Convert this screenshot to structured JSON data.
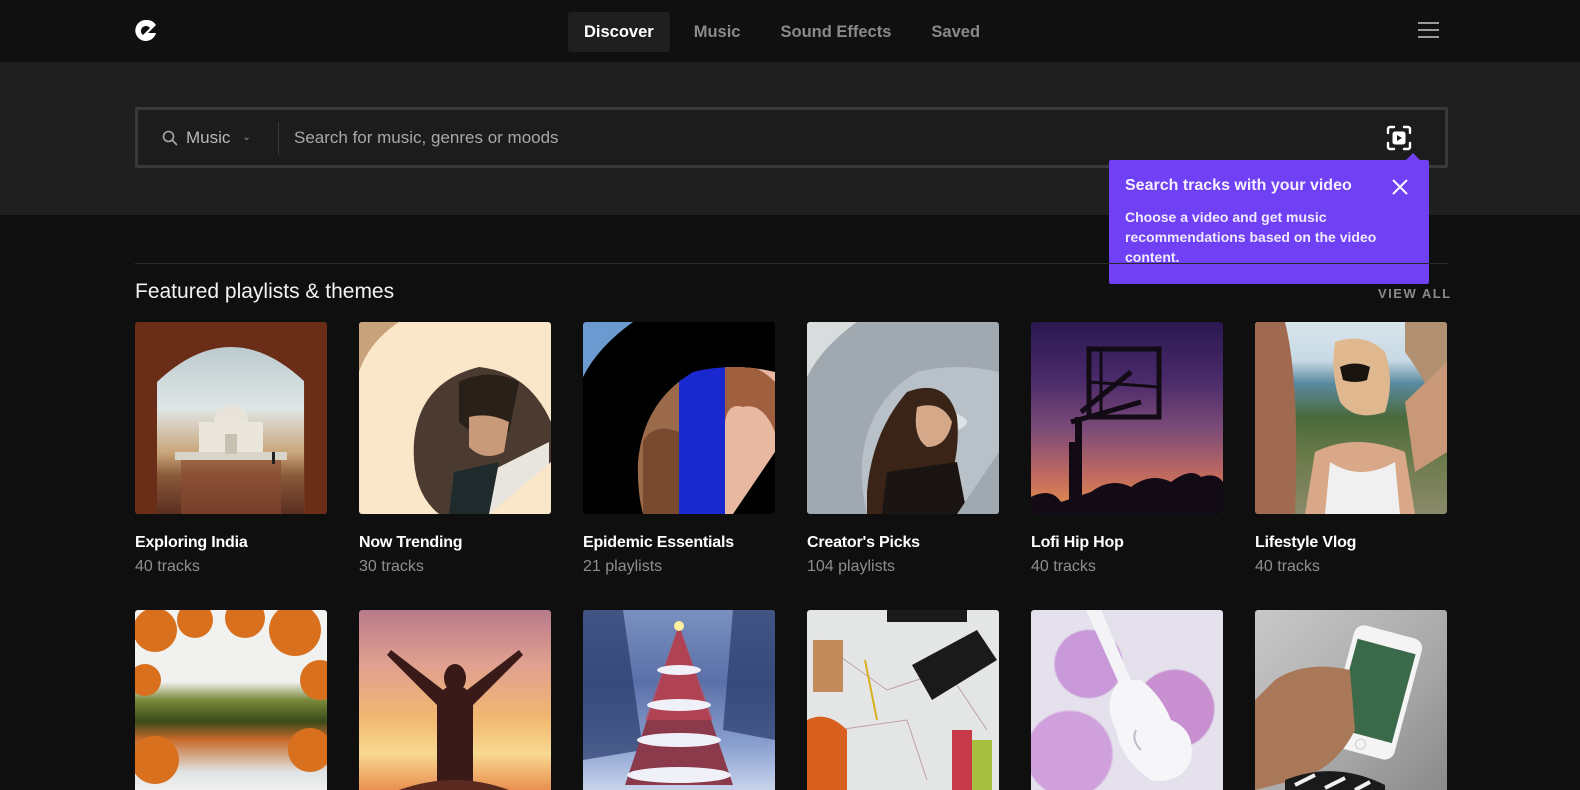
{
  "nav": {
    "logo_icon": "epidemic-logo-icon",
    "items": [
      {
        "label": "Discover",
        "active": true
      },
      {
        "label": "Music",
        "active": false
      },
      {
        "label": "Sound Effects",
        "active": false
      },
      {
        "label": "Saved",
        "active": false
      }
    ],
    "menu_icon": "hamburger-menu-icon"
  },
  "search": {
    "scope_label": "Music",
    "scope_icon": "search-icon",
    "placeholder": "Search for music, genres or moods",
    "value": "",
    "video_search_icon": "video-scan-icon"
  },
  "tooltip": {
    "title": "Search tracks with your video",
    "body": "Choose a video and get music recommendations based on the video content.",
    "close_icon": "close-icon",
    "color": "#7040f5"
  },
  "featured": {
    "title": "Featured playlists & themes",
    "view_all": "VIEW ALL",
    "row1": [
      {
        "title": "Exploring India",
        "subtitle": "40 tracks"
      },
      {
        "title": "Now Trending",
        "subtitle": "30 tracks"
      },
      {
        "title": "Epidemic Essentials",
        "subtitle": "21 playlists"
      },
      {
        "title": "Creator's Picks",
        "subtitle": "104 playlists"
      },
      {
        "title": "Lofi Hip Hop",
        "subtitle": "40 tracks"
      },
      {
        "title": "Lifestyle Vlog",
        "subtitle": "40 tracks"
      }
    ],
    "row2_images": [
      "autumn-lake",
      "sunset-silhouette",
      "snowy-christmas-tree",
      "travel-map-camera",
      "violin-lilac-flowers",
      "phone-in-hand"
    ]
  }
}
